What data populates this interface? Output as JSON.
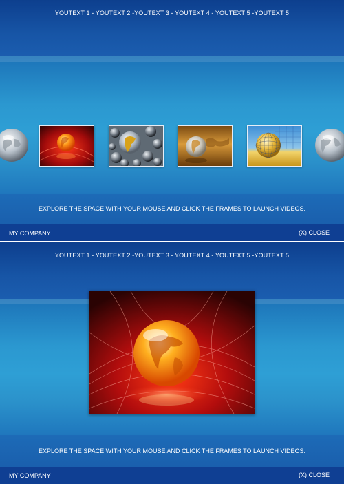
{
  "nav": {
    "text": "YOUTEXT 1 - YOUTEXT 2 -YOUTEXT 3 - YOUTEXT 4 - YOUTEXT 5 -YOUTEXT 5"
  },
  "instructions": "EXPLORE THE SPACE WITH YOUR MOUSE AND CLICK THE FRAMES TO LAUNCH VIDEOS.",
  "footer": {
    "company": "MY COMPANY",
    "close_label": "(X) CLOSE"
  },
  "colors": {
    "top_band": "#0d3f8e",
    "stage": "#2e9fd5",
    "bottom_bar": "#0f3f93",
    "text": "#ffffff"
  },
  "thumbnails": [
    {
      "icon": "globe-red-icon"
    },
    {
      "icon": "globe-spheres-icon"
    },
    {
      "icon": "globe-gold-icon"
    },
    {
      "icon": "globe-grid-icon"
    }
  ],
  "edge_globes": [
    "globe-silver-icon",
    "globe-silver-icon"
  ],
  "video_frame": {
    "icon": "globe-red-icon"
  }
}
